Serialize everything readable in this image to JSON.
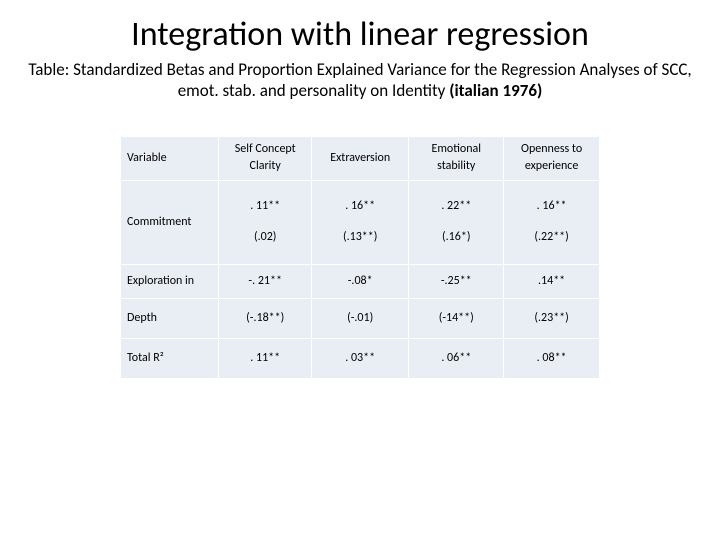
{
  "title": "Integration with linear regression",
  "subtitle_prefix": "Table: Standardized Betas and Proportion Explained Variance for the Regression Analyses of SCC, emot. stab. and personality on Identity  ",
  "subtitle_bold": "(italian 1976)",
  "headers": {
    "variable": "Variable",
    "scc_line1": "Self Concept",
    "scc_line2": "Clarity",
    "extraversion": "Extraversion",
    "emot_line1": "Emotional",
    "emot_line2": "stability",
    "open_line1": "Openness to",
    "open_line2": "experience"
  },
  "rows": {
    "commitment": {
      "label": "Commitment",
      "scc_v": ". 11**",
      "scc_p": "(.02)",
      "ext_v": ". 16**",
      "ext_p": "(.13**)",
      "emo_v": ". 22**",
      "emo_p": "(.16*)",
      "open_v": ". 16**",
      "open_p": "(.22**)"
    },
    "exploration": {
      "label": "Exploration in",
      "scc": "-. 21**",
      "ext": "-.08*",
      "emo": "-.25**",
      "open": ".14**"
    },
    "depth": {
      "label": "Depth",
      "scc": "(-.18**)",
      "ext": "(-.01)",
      "emo": "(-14**)",
      "open": "(.23**)"
    },
    "totalr2": {
      "label": "Total R²",
      "scc": ". 11**",
      "ext": ". 03**",
      "emo": ". 06**",
      "open": ". 08**"
    }
  },
  "chart_data": {
    "type": "table",
    "title": "Integration with linear regression",
    "columns": [
      "Variable",
      "Self Concept Clarity",
      "Extraversion",
      "Emotional stability",
      "Openness to experience"
    ],
    "rows": [
      [
        "Commitment (beta)",
        ".11**",
        ".16**",
        ".22**",
        ".16**"
      ],
      [
        "Commitment (paren)",
        "(.02)",
        "(.13**)",
        "(.16*)",
        "(.22**)"
      ],
      [
        "Exploration in",
        "-.21**",
        "-.08*",
        "-.25**",
        ".14**"
      ],
      [
        "Depth",
        "(-.18**)",
        "(-.01)",
        "(-14**)",
        "(.23**)"
      ],
      [
        "Total R²",
        ".11**",
        ".03**",
        ".06**",
        ".08**"
      ]
    ]
  }
}
